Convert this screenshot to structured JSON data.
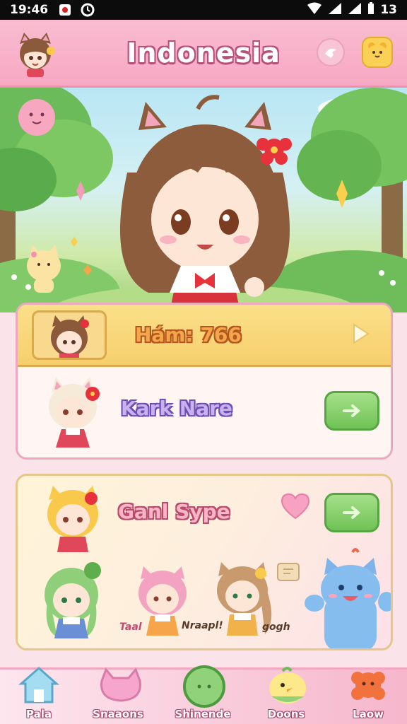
{
  "status_bar": {
    "time": "19:46",
    "right_text": "13"
  },
  "header": {
    "title": "Indonesia"
  },
  "card1": {
    "top_row_label": "Hám: 766",
    "bottom_row_label": "Kark Nare"
  },
  "card2": {
    "label": "Ganl Sype",
    "caption_left": "Taal",
    "caption_mid": "Nraapl!",
    "caption_right": "gogh"
  },
  "bottom_nav": {
    "items": [
      {
        "label": "Pala",
        "icon": "house-icon"
      },
      {
        "label": "Snaaons",
        "icon": "cat-cushion-icon"
      },
      {
        "label": "Shinende",
        "icon": "green-orb-icon"
      },
      {
        "label": "Doons",
        "icon": "chick-icon"
      },
      {
        "label": "Laow",
        "icon": "flower-icon"
      }
    ]
  },
  "colors": {
    "header_pink": "#f7a8c2",
    "gold": "#f6cf6c",
    "green_button": "#6fc256",
    "accent_brown": "#8a5a3b"
  }
}
